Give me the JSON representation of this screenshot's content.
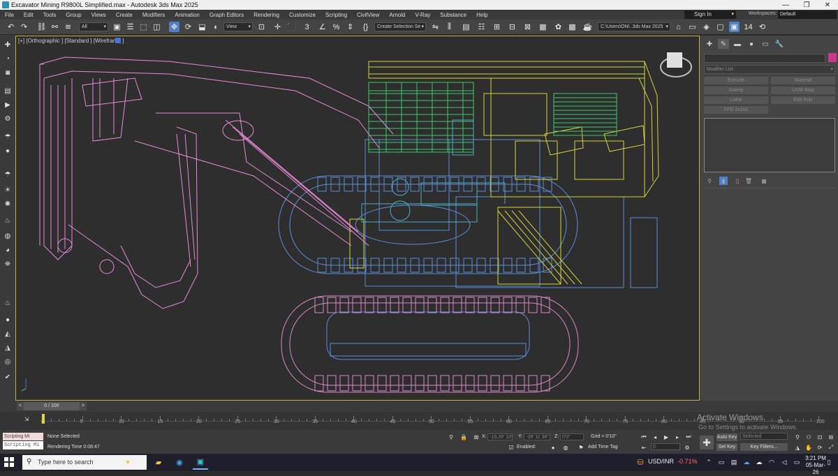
{
  "window": {
    "title": "Excavator Mining R9800L Simplified.max - Autodesk 3ds Max 2025",
    "minimize": "—",
    "maximize": "❐",
    "close": "✕"
  },
  "menu": {
    "items": [
      "File",
      "Edit",
      "Tools",
      "Group",
      "Views",
      "Create",
      "Modifiers",
      "Animation",
      "Graph Editors",
      "Rendering",
      "Customize",
      "Scripting",
      "CivilView",
      "Arnold",
      "V-Ray",
      "Substance",
      "Help"
    ],
    "sign_in": "Sign In",
    "workspaces_label": "Workspaces:",
    "workspaces_value": "Default"
  },
  "toolbar": {
    "selection_filter": "All",
    "ref_coord": "View",
    "named_selection": "Create Selection Se",
    "project_path": "C:\\Users\\ON\\ .3ds Max 2025",
    "snap_angle": "3",
    "snap_num": "14"
  },
  "viewport": {
    "label": "[+] [Orthographic ] [Standard ] [Wireframe ]"
  },
  "command_panel": {
    "modifier_list": "Modifier List",
    "buttons": [
      "Extrude",
      "Material",
      "Sweep",
      "UVW Map",
      "Lathe",
      "Edit Poly",
      "FFD 2x2x2"
    ]
  },
  "timeline": {
    "frame_display": "0 / 100",
    "tick_labels": [
      "0",
      "5",
      "10",
      "15",
      "20",
      "25",
      "30",
      "35",
      "40",
      "45",
      "50",
      "55",
      "60",
      "65",
      "70",
      "75",
      "80",
      "85",
      "90",
      "95",
      "100"
    ]
  },
  "status": {
    "script_label": "Scripting Mi",
    "script_listener": "Scripting Mi",
    "selection": "None Selected",
    "render_time": "Rendering Time  0:08:47",
    "x_label": "X:",
    "x_value": "-19.39' 10\"",
    "y_label": "Y:",
    "y_value": "-39' 11 38\"",
    "z_label": "Z:",
    "z_value": "0'0\"",
    "grid": "Grid = 0'10\"",
    "enabled_label": "Enabled:",
    "add_time_tag": "Add Time Tag",
    "frame_value": "0",
    "auto_key": "Auto Key",
    "set_key": "Set Key",
    "selected": "Selected",
    "key_filters": "Key Filters..."
  },
  "watermark": {
    "line1": "Activate Windows",
    "line2": "Go to Settings to activate Windows."
  },
  "taskbar": {
    "search_placeholder": "Type here to search",
    "currency": "USD/INR",
    "change": "-0.71%",
    "time": "3:21 PM",
    "date": "05-Mar-26"
  },
  "colors": {
    "boom": "#e88ad8",
    "tracks": "#5b8ed8",
    "tracks_pink": "#d88ac8",
    "house_yellow": "#d6d63a",
    "green": "#3cc86a",
    "cyan": "#4ab0c8",
    "selection_border": "#c4b24c",
    "active_tool": "#4f7fc4"
  }
}
